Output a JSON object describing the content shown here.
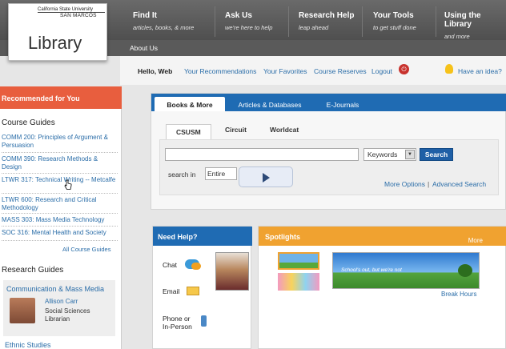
{
  "logo": {
    "university": "California State University",
    "campus": "SAN MARCOS",
    "title": "Library"
  },
  "nav": [
    {
      "title": "Find It",
      "subtitle": "articles, books, & more"
    },
    {
      "title": "Ask Us",
      "subtitle": "we're here to help"
    },
    {
      "title": "Research Help",
      "subtitle": "leap ahead"
    },
    {
      "title": "Your Tools",
      "subtitle": "to get stuff done"
    },
    {
      "title": "Using the Library",
      "subtitle": "and more"
    }
  ],
  "subnav": {
    "about": "About Us"
  },
  "userbar": {
    "hello": "Hello, Web",
    "links": [
      "Your Recommendations",
      "Your Favorites",
      "Course Reserves",
      "Logout"
    ],
    "idea": "Have an idea?"
  },
  "sidebar": {
    "recommended_title": "Recommended for You",
    "course_guides_title": "Course Guides",
    "course_guides": [
      "COMM 200: Principles of Argument & Persuasion",
      "COMM 390: Research Methods & Design",
      "LTWR 317: Technical Writing -- Metcalfe",
      "LTWR 600: Research and Critical Methodology",
      "MASS 303: Mass Media Technology",
      "SOC 316: Mental Health and Society"
    ],
    "all_course_guides": "All Course Guides",
    "research_guides_title": "Research Guides",
    "research_guide": {
      "title": "Communication & Mass Media",
      "librarian": "Allison Carr",
      "role_line1": "Social Sciences",
      "role_line2": "Librarian"
    },
    "next_guide": "Ethnic Studies"
  },
  "search": {
    "tabs": [
      "Books & More",
      "Articles & Databases",
      "E-Journals"
    ],
    "subtabs": [
      "CSUSM",
      "Circuit",
      "Worldcat"
    ],
    "query": "",
    "field": "Keywords",
    "button": "Search",
    "search_in_label": "search in",
    "scope": "Entire",
    "more_options": "More Options",
    "divider": "|",
    "advanced": "Advanced Search"
  },
  "help": {
    "title": "Need Help?",
    "chat": "Chat",
    "email": "Email",
    "phone_line1": "Phone or",
    "phone_line2": "In-Person"
  },
  "spotlights": {
    "title": "Spotlights",
    "more": "More",
    "banner_text": "School's out, but we're not",
    "banner_caption": "Break Hours"
  }
}
